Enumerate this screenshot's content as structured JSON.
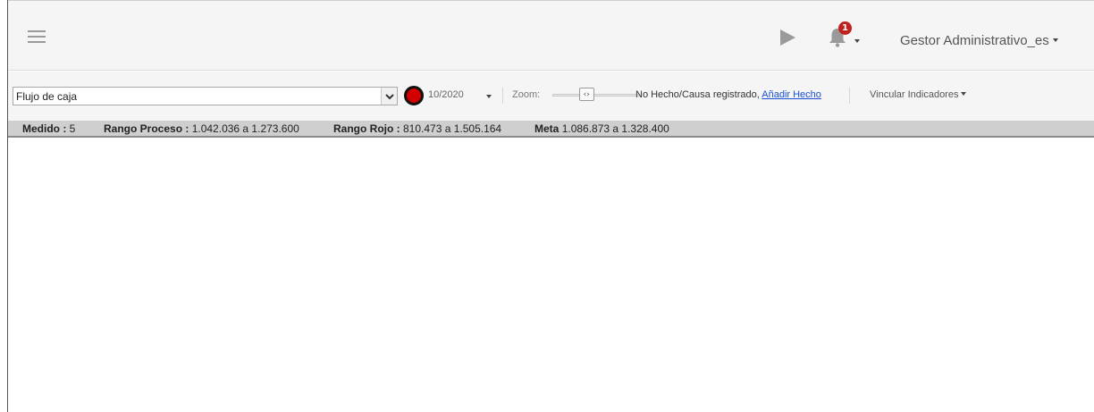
{
  "navbar": {
    "notification_count": "1",
    "user_name": "Gestor Administrativo_es"
  },
  "toolbar": {
    "indicator_value": "Flujo de caja",
    "status_color": "#d20000",
    "period": "10/2020",
    "zoom_label": "Zoom:",
    "zoom_level": 0.39,
    "no_hecho_text": "No Hecho/Causa registrado,",
    "add_hecho_link": "Añadir Hecho",
    "vincular_label": "Vincular Indicadores"
  },
  "stats": {
    "medido_label": "Medido :",
    "medido_value": "5",
    "rango_proceso_label": "Rango Proceso :",
    "rango_proceso_value": "1.042.036 a 1.273.600",
    "rango_rojo_label": "Rango Rojo :",
    "rango_rojo_value": "810.473 a 1.505.164",
    "meta_label": "Meta",
    "meta_value": "1.086.873 a 1.328.400"
  }
}
